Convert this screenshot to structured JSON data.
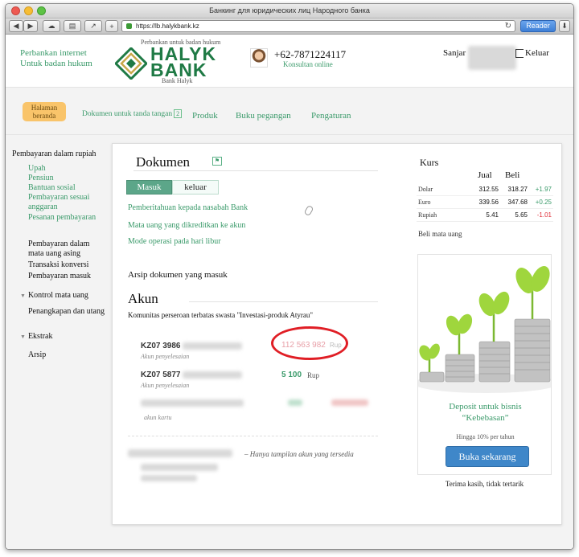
{
  "browser": {
    "title": "Банкинг для юридических лиц Народного банка",
    "url": "https://lb.halykbank.kz",
    "reader": "Reader"
  },
  "header": {
    "internet_banking": "Perbankan internet",
    "for_legal": "Untuk badan hukum",
    "logo_above": "Perbankan untuk badan hukum",
    "logo_line1": "HALYK",
    "logo_line2": "BANK",
    "logo_below": "Bank Halyk",
    "phone": "+62-7871224117",
    "consult": "Konsultan online",
    "user": "Sanjar",
    "logout": "Keluar",
    "accent": "#3a9a6a"
  },
  "nav": {
    "home": "Halaman beranda",
    "documents": "Dokumen untuk tanda tangan",
    "documents_badge": "2",
    "products": "Produk",
    "guide": "Buku pegangan",
    "settings": "Pengaturan"
  },
  "sidebar": {
    "rupiah_header": "Pembayaran dalam rupiah",
    "rupiah_items": [
      "Upah",
      "Pensiun",
      "Bantuan sosial",
      "Pembayaran sesuai anggaran",
      "Pesanan pembayaran"
    ],
    "foreign1": "Pembayaran dalam",
    "foreign2": "mata uang asing",
    "conversion": "Transaksi konversi",
    "incoming": "Pembayaran masuk",
    "currency_control": "Kontrol mata uang",
    "debt": "Penangkapan dan utang",
    "statement": "Ekstrak",
    "archive": "Arsip"
  },
  "documents": {
    "title": "Dokumen",
    "flag_icon": "flag-icon",
    "tab_in": "Masuk",
    "tab_out": "keluar",
    "links": [
      "Pemberitahuan kepada nasabah Bank",
      "Mata uang yang dikreditkan ke akun",
      "Mode operasi pada hari libur"
    ],
    "archive": "Arsip dokumen yang masuk"
  },
  "accounts": {
    "title": "Akun",
    "company": "Komunitas perseroan terbatas swasta  \"Investasi-produk Atyrau\"",
    "rows": [
      {
        "number": "KZ07 3986",
        "type": "Akun penyelesaian",
        "amount": "112 563 982",
        "currency": "Rup",
        "amount_color": "#e8a0a8"
      },
      {
        "number": "KZ07 5877",
        "type": "Akun penyelesaian",
        "amount": "5 100",
        "currency": "Rup",
        "amount_color": "#3a9a6a"
      },
      {
        "number": "",
        "type": "akun kartu",
        "amount": "",
        "currency": "",
        "amount_color": "#3a9a6a"
      }
    ],
    "note": "Hanya tampilan akun yang tersedia"
  },
  "rates": {
    "title": "Kurs",
    "col_sell": "Jual",
    "col_buy": "Beli",
    "rows": [
      {
        "name": "Dolar",
        "sell": "312.55",
        "buy": "318.27",
        "delta": "+1.97",
        "delta_color": "#3a9a6a"
      },
      {
        "name": "Euro",
        "sell": "339.56",
        "buy": "347.68",
        "delta": "+0.25",
        "delta_color": "#3a9a6a"
      },
      {
        "name": "Rupiah",
        "sell": "5.41",
        "buy": "5.65",
        "delta": "-1.01",
        "delta_color": "#e0303a"
      }
    ],
    "buy_link": "Beli mata uang"
  },
  "promo": {
    "title1": "Deposit untuk bisnis",
    "title2": "“Kebebasan”",
    "subtitle": "Hingga 10% per tahun",
    "button": "Buka sekarang",
    "decline": "Terima kasih, tidak tertarik"
  }
}
